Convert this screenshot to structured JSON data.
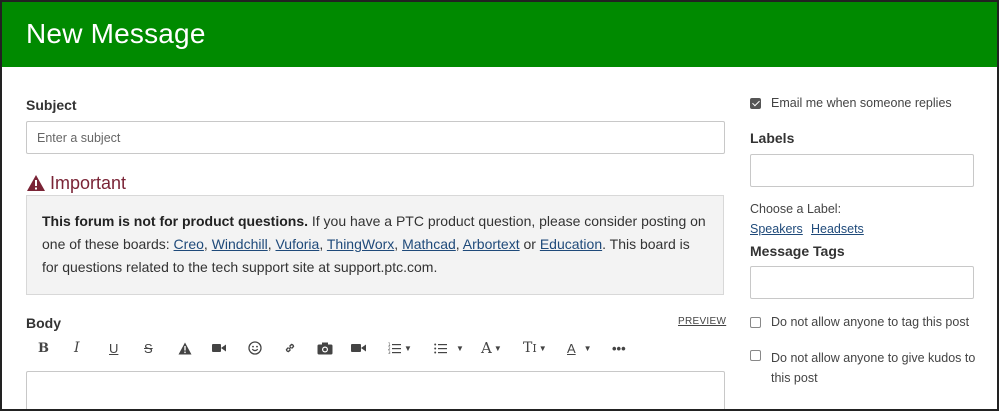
{
  "header": {
    "title": "New Message"
  },
  "subject": {
    "label": "Subject",
    "placeholder": "Enter a subject"
  },
  "important": {
    "heading": "Important",
    "bold": "This forum is not for product questions.",
    "text1": " If you have a PTC product question, please consider posting on one of these boards: ",
    "links": [
      "Creo",
      "Windchill",
      "Vuforia",
      "ThingWorx",
      "Mathcad",
      "Arbortext",
      "Education"
    ],
    "sep_comma": ", ",
    "sep_or": " or ",
    "text2": ". This board is for questions related to the tech support site at support.ptc.com."
  },
  "body": {
    "label": "Body",
    "preview": "PREVIEW"
  },
  "toolbar": {
    "buttons": [
      "bold-icon",
      "italic-icon",
      "underline-icon",
      "strikethrough-icon",
      "warning-icon",
      "video-icon",
      "emoji-icon",
      "link-icon",
      "camera-icon",
      "video-camera-icon",
      "numbered-list-icon",
      "bullet-list-icon",
      "font-family-icon",
      "font-size-icon",
      "text-color-icon",
      "more-icon"
    ]
  },
  "sidebar": {
    "email_replies": {
      "label": "Email me when someone replies",
      "checked": true
    },
    "labels": {
      "heading": "Labels",
      "choose": "Choose a Label:",
      "options": [
        "Speakers",
        "Headsets"
      ]
    },
    "tags": {
      "heading": "Message Tags"
    },
    "no_tag": {
      "label": "Do not allow anyone to tag this post",
      "checked": false
    },
    "no_kudos": {
      "label": "Do not allow anyone to give kudos to this post",
      "checked": false
    }
  },
  "colors": {
    "header_bg": "#008a00",
    "important": "#7a2436",
    "link": "#1f4a7a"
  }
}
